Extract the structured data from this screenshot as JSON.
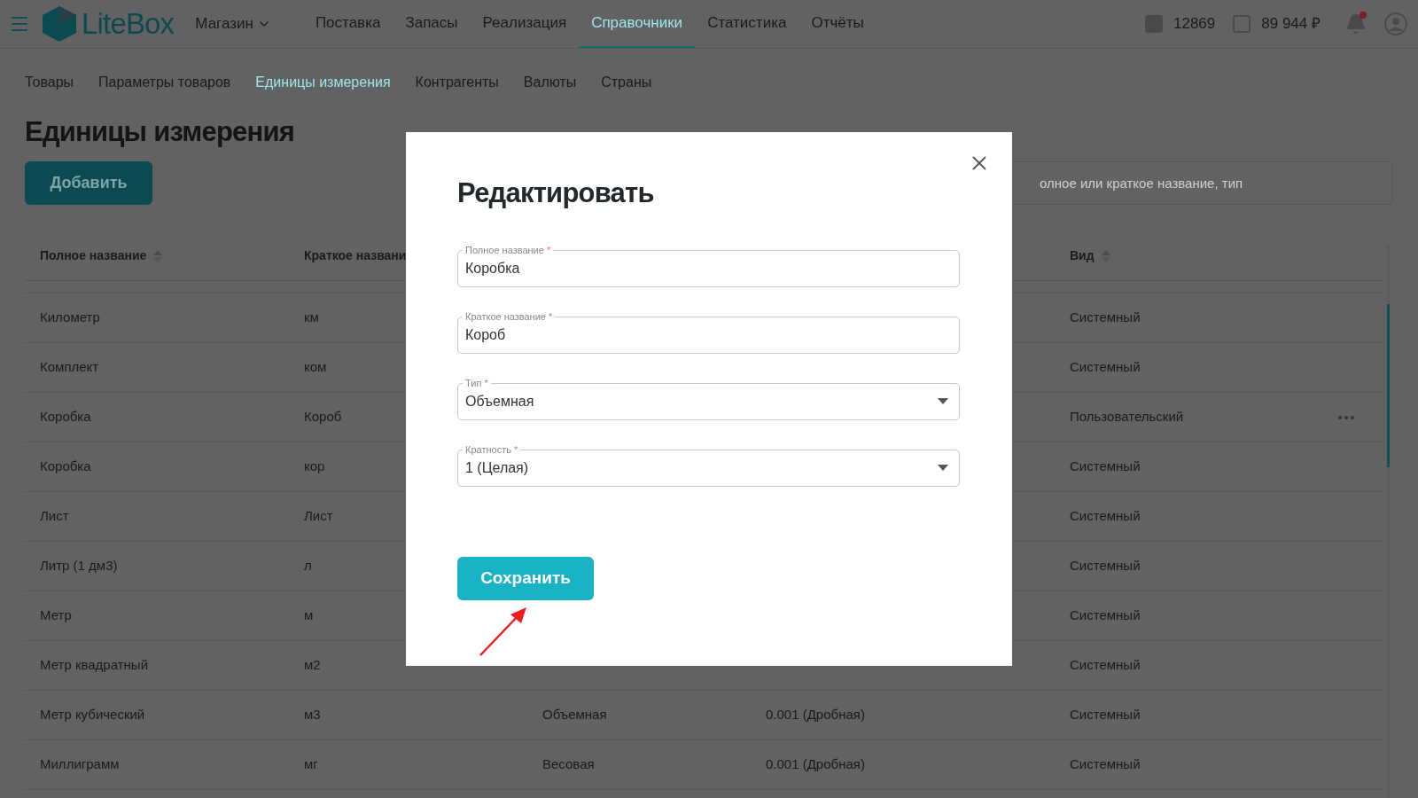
{
  "header": {
    "logo": "LiteBox",
    "store": "Магазин",
    "nav": [
      {
        "label": "Поставка",
        "selected": false
      },
      {
        "label": "Запасы",
        "selected": false
      },
      {
        "label": "Реализация",
        "selected": false
      },
      {
        "label": "Справочники",
        "selected": true
      },
      {
        "label": "Статистика",
        "selected": false
      },
      {
        "label": "Отчёты",
        "selected": false
      }
    ],
    "id_value": "12869",
    "balance": "89 944 ₽",
    "has_notification": true
  },
  "subnav": [
    {
      "label": "Товары",
      "selected": false
    },
    {
      "label": "Параметры товаров",
      "selected": false
    },
    {
      "label": "Единицы измерения",
      "selected": true
    },
    {
      "label": "Контрагенты",
      "selected": false
    },
    {
      "label": "Валюты",
      "selected": false
    },
    {
      "label": "Страны",
      "selected": false
    }
  ],
  "page_title": "Единицы измерения",
  "add_button": "Добавить",
  "search": {
    "placeholder": "олное или краткое название, тип"
  },
  "table": {
    "headers": {
      "full_name": {
        "label": "Полное название",
        "sortable": true
      },
      "short_name": {
        "label": "Краткое названи",
        "sortable": false
      },
      "kind": {
        "label": "Вид",
        "sortable": true
      }
    },
    "rows": [
      {
        "full_name": "Километр",
        "short_name": "км",
        "kind": "Системный",
        "has_menu": false
      },
      {
        "full_name": "Комплект",
        "short_name": "ком",
        "kind": "Системный",
        "has_menu": false
      },
      {
        "full_name": "Коробка",
        "short_name": "Короб",
        "kind": "Пользовательский",
        "has_menu": true
      },
      {
        "full_name": "Коробка",
        "short_name": "кор",
        "kind": "Системный",
        "has_menu": false
      },
      {
        "full_name": "Лист",
        "short_name": "Лист",
        "kind": "Системный",
        "has_menu": false
      },
      {
        "full_name": "Литр (1 дм3)",
        "short_name": "л",
        "kind": "Системный",
        "has_menu": false
      },
      {
        "full_name": "Метр",
        "short_name": "м",
        "kind": "Системный",
        "has_menu": false
      },
      {
        "full_name": "Метр квадратный",
        "short_name": "м2",
        "kind": "Системный",
        "has_menu": false
      },
      {
        "full_name": "Метр кубический",
        "short_name": "м3",
        "type": "Объемная",
        "multiplicity": "0.001 (Дробная)",
        "kind": "Системный",
        "has_menu": false
      },
      {
        "full_name": "Миллиграмм",
        "short_name": "мг",
        "type": "Весовая",
        "multiplicity": "0.001 (Дробная)",
        "kind": "Системный",
        "has_menu": false
      }
    ]
  },
  "modal": {
    "title": "Редактировать",
    "fields": [
      {
        "label": "Полное название",
        "required_mark": "*",
        "value": "Коробка",
        "kind": "text"
      },
      {
        "label": "Краткое название",
        "required_mark": "*",
        "value": "Короб",
        "kind": "text"
      },
      {
        "label": "Тип",
        "required_mark": "*",
        "value": "Объемная",
        "kind": "select"
      },
      {
        "label": "Кратность",
        "required_mark": "*",
        "value": "1 (Целая)",
        "kind": "select"
      }
    ],
    "save_button": "Сохранить"
  }
}
